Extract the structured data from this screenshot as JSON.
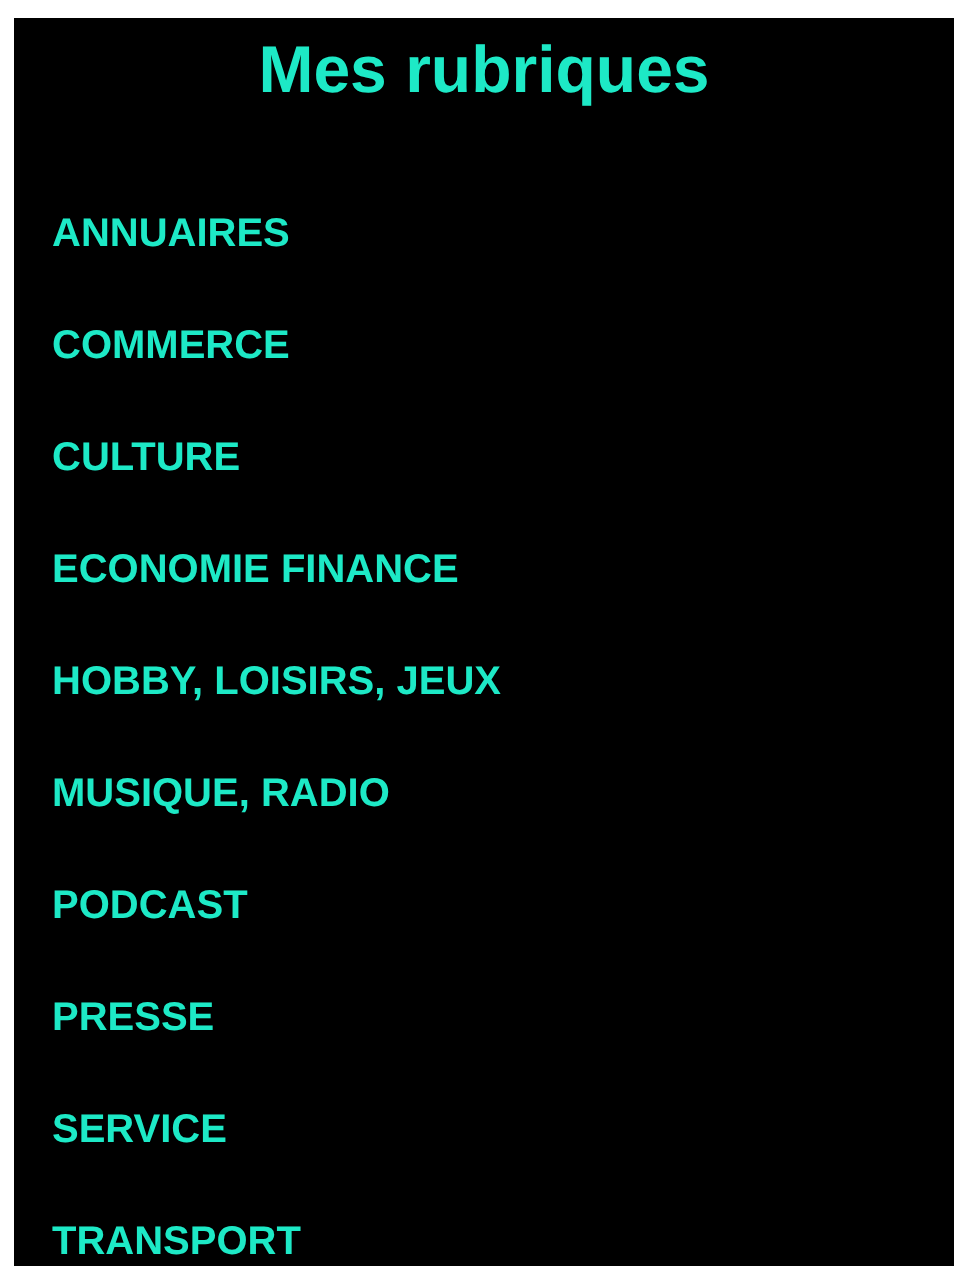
{
  "title": "Mes rubriques",
  "categories": [
    {
      "label": "ANNUAIRES"
    },
    {
      "label": "COMMERCE"
    },
    {
      "label": "CULTURE"
    },
    {
      "label": "ECONOMIE FINANCE"
    },
    {
      "label": "HOBBY, LOISIRS, JEUX"
    },
    {
      "label": "MUSIQUE, RADIO"
    },
    {
      "label": "PODCAST"
    },
    {
      "label": "PRESSE"
    },
    {
      "label": "SERVICE"
    },
    {
      "label": "TRANSPORT"
    }
  ]
}
